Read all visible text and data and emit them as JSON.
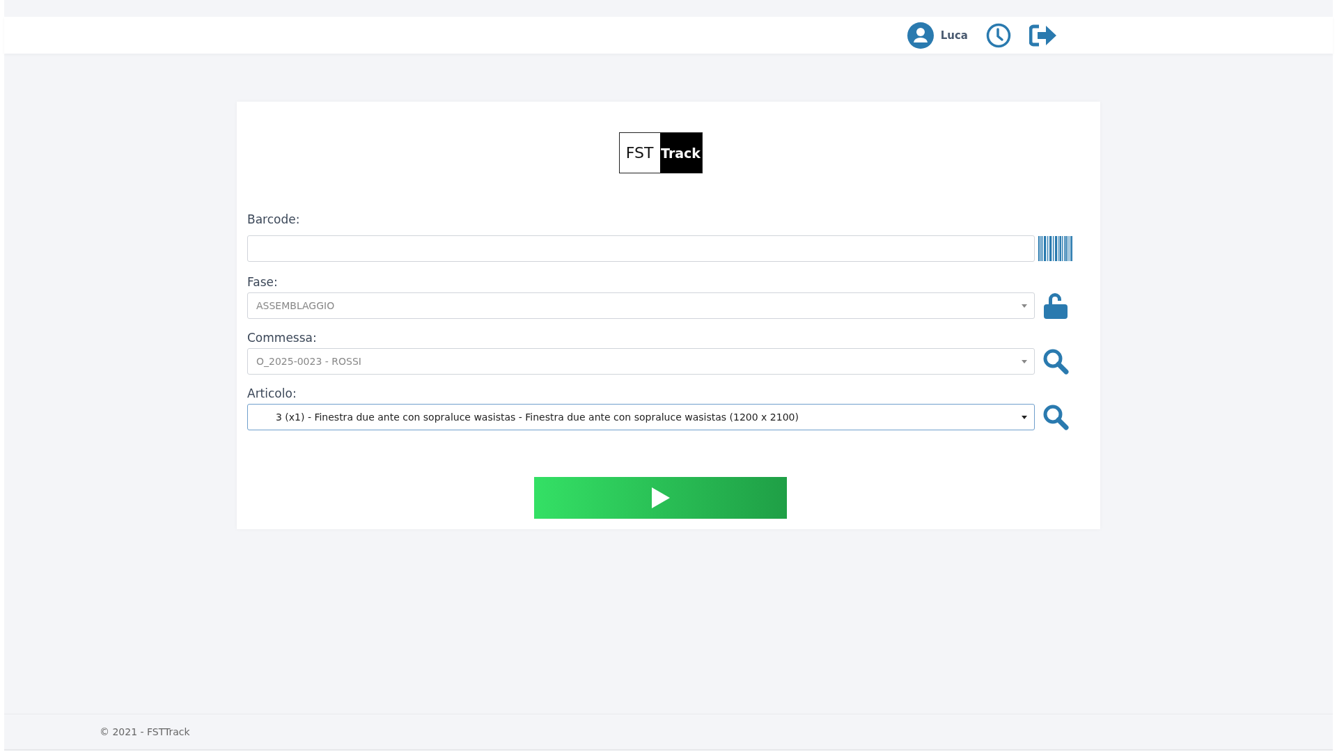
{
  "header": {
    "user": "Luca"
  },
  "logo": {
    "left": "FST",
    "right": "Track"
  },
  "fields": [
    {
      "kind": "text",
      "label": "Barcode:",
      "disabled": false
    },
    {
      "kind": "select",
      "label": "Fase:",
      "value": "ASSEMBLAGGIO",
      "disabled": true
    },
    {
      "kind": "select",
      "label": "Commessa:",
      "value": "O_2025-0023 - ROSSI",
      "disabled": true
    },
    {
      "kind": "select",
      "label": "Articolo:",
      "value": "3 (x1) - Finestra due ante con sopraluce wasistas - Finestra due ante con sopraluce wasistas (1200 x 2100)",
      "disabled": false
    }
  ],
  "footer": {
    "text": "© 2021 - FSTTrack"
  }
}
